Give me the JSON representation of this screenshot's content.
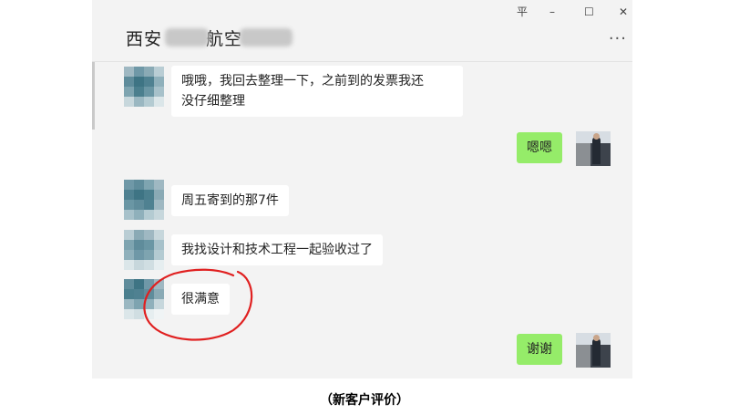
{
  "window": {
    "controls": {
      "pin": "平",
      "minimize": "–",
      "maximize": "☐",
      "close": "✕"
    },
    "more_icon": "···"
  },
  "chat": {
    "title_part1": "西安",
    "title_part2": "航空",
    "messages": [
      {
        "side": "left",
        "text": "哦哦，我回去整理一下，之前到的发票我还\n没仔细整理"
      },
      {
        "side": "right",
        "text": "嗯嗯"
      },
      {
        "side": "left",
        "text": "周五寄到的那7件"
      },
      {
        "side": "left",
        "text": "我找设计和技术工程一起验收过了"
      },
      {
        "side": "left",
        "text": "很满意",
        "annotated": true
      },
      {
        "side": "right",
        "text": "谢谢"
      }
    ]
  },
  "annotation": {
    "color": "#e02020",
    "shape": "hand-drawn ellipse"
  },
  "colors": {
    "my_bubble": "#95ec69",
    "other_bubble": "#ffffff",
    "background": "#f3f3f3"
  },
  "caption": "（新客户评价）"
}
